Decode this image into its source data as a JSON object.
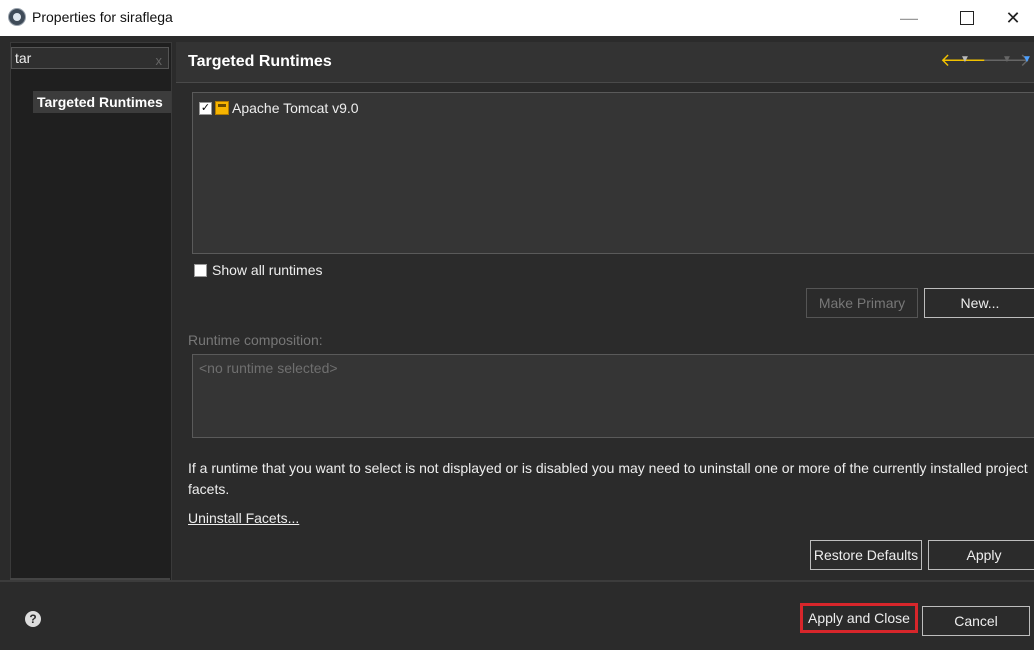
{
  "window": {
    "title": "Properties for siraflega",
    "minimize_glyph": "—",
    "close_glyph": "✕"
  },
  "left": {
    "filter_value": "tar",
    "filter_clear_glyph": "x",
    "tree_items": [
      {
        "label": "Targeted Runtimes"
      }
    ]
  },
  "page": {
    "title": "Targeted Runtimes",
    "nav_back_glyph": "🡐",
    "nav_forward_glyph": "🡒",
    "dropdown_glyph": "▼"
  },
  "runtimes": {
    "items": [
      {
        "label": "Apache Tomcat v9.0",
        "checked": true,
        "check_glyph": "✓"
      }
    ]
  },
  "show_all": {
    "label": "Show all runtimes",
    "checked": false
  },
  "buttons": {
    "make_primary": "Make Primary",
    "new": "New...",
    "restore_defaults": "Restore Defaults",
    "apply": "Apply",
    "apply_and_close": "Apply and Close",
    "cancel": "Cancel"
  },
  "composition": {
    "label": "Runtime composition:",
    "placeholder": "<no runtime selected>"
  },
  "info_text": "If a runtime that you want to select is not displayed or is disabled you may need to uninstall one or more of the currently installed project facets.",
  "link_text": "Uninstall Facets...",
  "help_glyph": "?",
  "colors": {
    "dialog_bg": "#2b2b2b",
    "highlight_border": "#d7262b",
    "nav_back": "#f2c200",
    "nav_menu": "#4da0ff"
  }
}
